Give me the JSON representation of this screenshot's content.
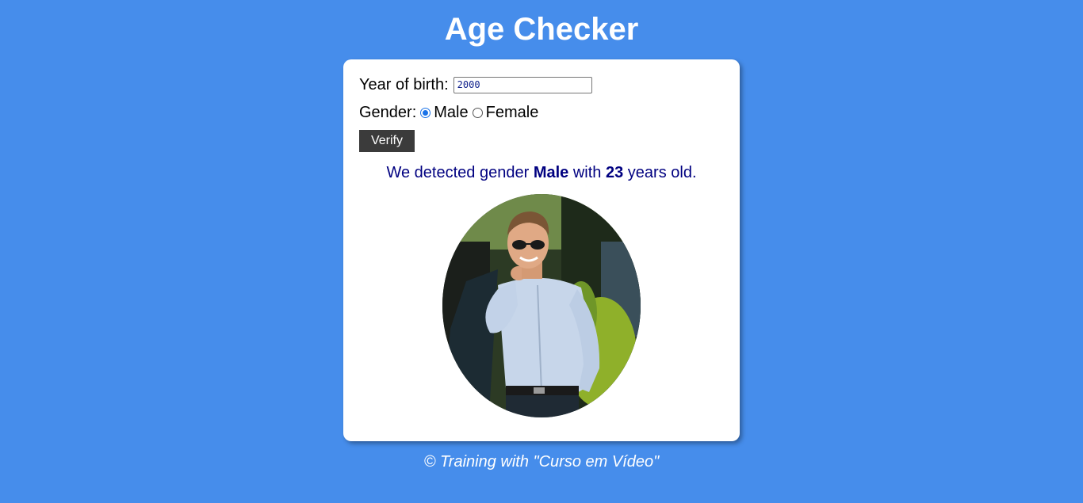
{
  "header": {
    "title": "Age Checker"
  },
  "form": {
    "year_label": "Year of birth:",
    "year_value": "2000",
    "gender_label": "Gender:",
    "gender_options": [
      "Male",
      "Female"
    ],
    "gender_selected": "Male",
    "verify_label": "Verify"
  },
  "result": {
    "prefix": "We detected gender",
    "gender": "Male",
    "middle": "with",
    "age": "23",
    "suffix": "years old."
  },
  "photo": {
    "icon": "man-portrait-image"
  },
  "footer": {
    "text": "© Training with \"Curso em Vídeo\""
  },
  "colors": {
    "background": "#468deb",
    "card": "#ffffff",
    "result_text": "#000080",
    "button": "#3b3b3b"
  }
}
